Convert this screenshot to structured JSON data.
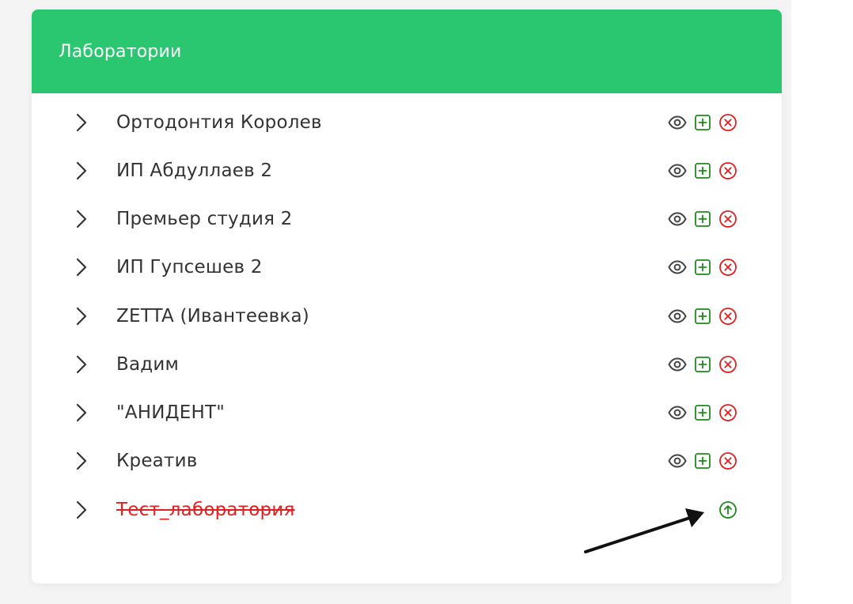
{
  "card": {
    "title": "Лаборатории"
  },
  "colors": {
    "header": "#2ac770",
    "view_icon": "#444444",
    "add_icon": "#1d8a1d",
    "delete_icon": "#e02020",
    "restore_icon": "#1d8a1d",
    "deleted_text": "#e02020"
  },
  "labs": [
    {
      "name": "Ортодонтия Королев",
      "deleted": false
    },
    {
      "name": "ИП Абдуллаев 2",
      "deleted": false
    },
    {
      "name": "Премьер студия 2",
      "deleted": false
    },
    {
      "name": "ИП Гупсешев 2",
      "deleted": false
    },
    {
      "name": "ZETTA (Ивантеевка)",
      "deleted": false
    },
    {
      "name": "Вадим",
      "deleted": false
    },
    {
      "name": "\"АНИДЕНТ\"",
      "deleted": false
    },
    {
      "name": "Креатив",
      "deleted": false
    },
    {
      "name": "Тест_лаборатория",
      "deleted": true
    }
  ],
  "icons": {
    "expand": "chevron-right-icon",
    "view": "eye-icon",
    "add": "plus-square-icon",
    "delete": "x-circle-icon",
    "restore": "arrow-up-circle-icon",
    "annotation": "arrow-annotation"
  }
}
